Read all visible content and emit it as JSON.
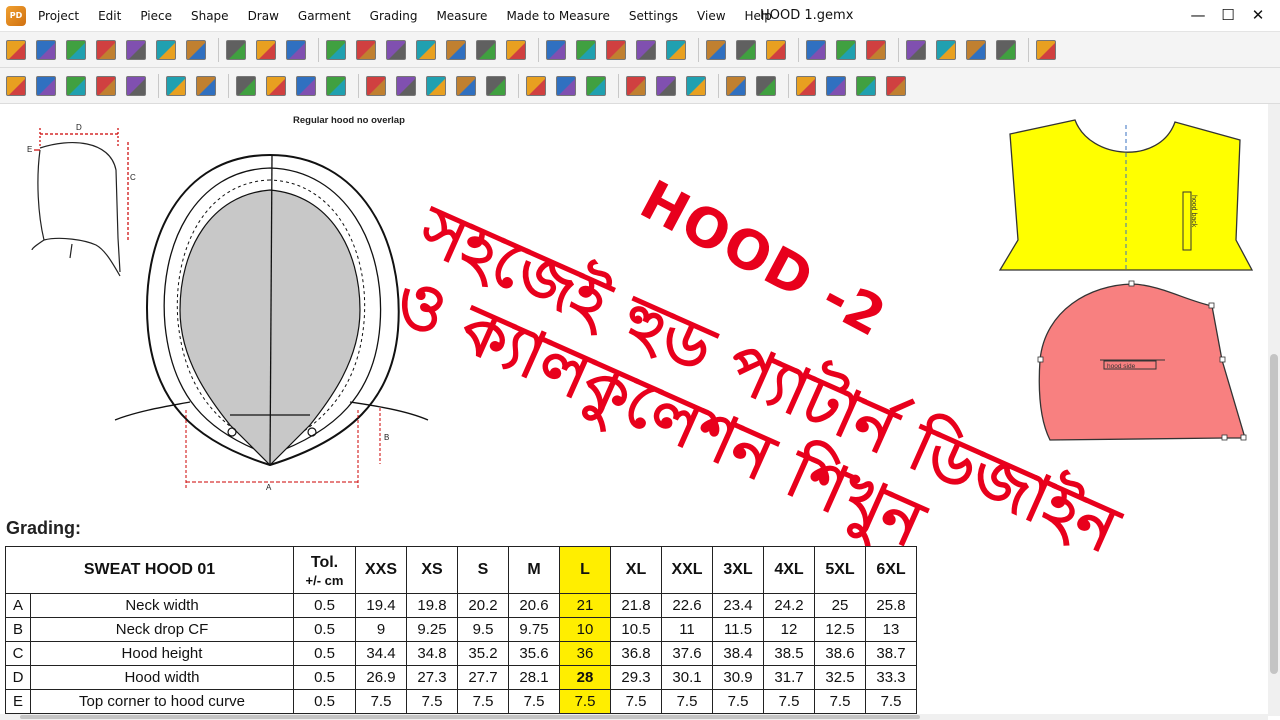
{
  "menubar": {
    "items": [
      "Project",
      "Edit",
      "Piece",
      "Shape",
      "Draw",
      "Garment",
      "Grading",
      "Measure",
      "Made to Measure",
      "Settings",
      "View",
      "Help"
    ],
    "title": "HOOD 1.gemx",
    "controls": {
      "minimize": "—",
      "maximize": "☐",
      "close": "✕"
    }
  },
  "toolbar_icons": {
    "row1": [
      "new-file-icon",
      "open-folder-icon",
      "old-file-icon",
      "save-icon",
      "tree-icon",
      "undo-icon",
      "redo-icon",
      "zoom-fit-icon",
      "zoom-in-icon",
      "zoom-out-icon",
      "text-icon",
      "fill-icon",
      "piece-copy-icon",
      "piece-align-icon",
      "piece-mirror-icon",
      "piece-shape-icon",
      "play-icon",
      "document-icon",
      "grid-icon",
      "eye-icon",
      "notch-icon",
      "measure-tool-icon",
      "3d-view-icon",
      "mark-icon",
      "grading-icon",
      "person-icon",
      "scissors-icon",
      "check-icon",
      "plot-icon",
      "print-icon",
      "export-icon",
      "settings-icon",
      "help-icon"
    ],
    "row2": [
      "folder-piece-icon",
      "list-icon",
      "cut-icon",
      "delete-icon",
      "color-wheel-icon",
      "add-point-icon",
      "add-piece-icon",
      "copy-piece-icon",
      "paste-piece-icon",
      "rotate-icon",
      "lock-icon",
      "frame-icon",
      "block-icon",
      "piece-edit-icon",
      "flip-icon",
      "mirror-icon",
      "align-left-icon",
      "align-center-icon",
      "bracket-icon",
      "expand-icon",
      "fold-icon",
      "send-icon",
      "arrows-icon",
      "fast-forward-icon",
      "connect-icon",
      "merge-icon",
      "split-icon",
      "finish-icon"
    ]
  },
  "drawing": {
    "caption": "Regular hood no overlap",
    "dim_labels": {
      "a": "A",
      "b": "B",
      "c": "C",
      "d": "D",
      "e": "E"
    },
    "yellow_piece_text": "hood back",
    "pink_piece_text": "hood side"
  },
  "colors": {
    "promo_red": "#e8001c",
    "highlight": "#ffee00",
    "yellow_piece": "#ffff00",
    "pink_piece": "#f88080"
  },
  "promo": {
    "line1": "HOOD -2",
    "line2": "সহজেই হুড প্যাটার্ন ডিজাইন",
    "line3": "ও ক্যালকুলেশন শিখুন"
  },
  "grading": {
    "heading": "Grading:",
    "table_name": "SWEAT HOOD 01",
    "tol_label": "Tol.",
    "tol_unit": "+/- cm",
    "sizes": [
      "XXS",
      "XS",
      "S",
      "M",
      "L",
      "XL",
      "XXL",
      "3XL",
      "4XL",
      "5XL",
      "6XL"
    ],
    "highlighted_size": "L",
    "rows": [
      {
        "letter": "A",
        "label": "Neck width",
        "tol": "0.5",
        "values": [
          "19.4",
          "19.8",
          "20.2",
          "20.6",
          "21",
          "21.8",
          "22.6",
          "23.4",
          "24.2",
          "25",
          "25.8"
        ]
      },
      {
        "letter": "B",
        "label": "Neck drop CF",
        "tol": "0.5",
        "values": [
          "9",
          "9.25",
          "9.5",
          "9.75",
          "10",
          "10.5",
          "11",
          "11.5",
          "12",
          "12.5",
          "13"
        ]
      },
      {
        "letter": "C",
        "label": "Hood height",
        "tol": "0.5",
        "values": [
          "34.4",
          "34.8",
          "35.2",
          "35.6",
          "36",
          "36.8",
          "37.6",
          "38.4",
          "38.5",
          "38.6",
          "38.7"
        ]
      },
      {
        "letter": "D",
        "label": "Hood width",
        "tol": "0.5",
        "values": [
          "26.9",
          "27.3",
          "27.7",
          "28.1",
          "28",
          "29.3",
          "30.1",
          "30.9",
          "31.7",
          "32.5",
          "33.3"
        ]
      },
      {
        "letter": "E",
        "label": "Top corner to hood curve",
        "tol": "0.5",
        "values": [
          "7.5",
          "7.5",
          "7.5",
          "7.5",
          "7.5",
          "7.5",
          "7.5",
          "7.5",
          "7.5",
          "7.5",
          "7.5"
        ]
      }
    ]
  }
}
